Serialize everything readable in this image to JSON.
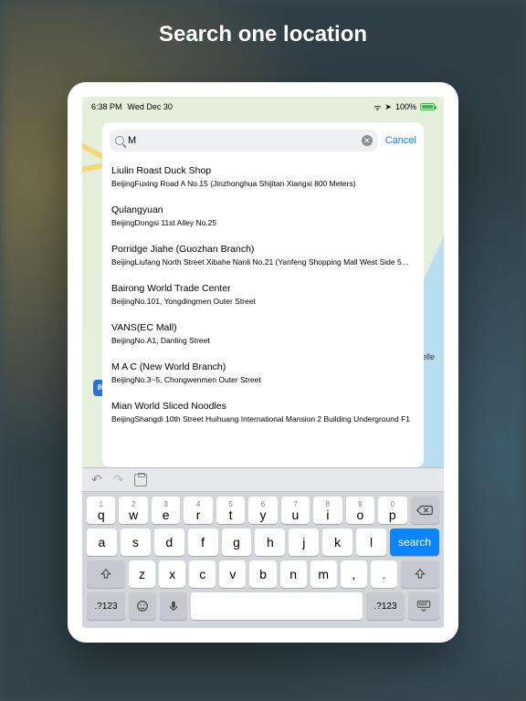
{
  "page": {
    "title": "Search one location"
  },
  "status": {
    "time": "6:38 PM",
    "date": "Wed Dec 30",
    "battery_pct": "100%"
  },
  "map": {
    "shield_label": "80",
    "place_label": "Rochelle"
  },
  "search": {
    "query": "M",
    "cancel_label": "Cancel",
    "clear_glyph": "✕"
  },
  "results": [
    {
      "title": "Liulin Roast Duck Shop",
      "subtitle": "BeijingFuxing Road A No.15 (Jinzhonghua Shijitan Xiangxi 800 Meters)"
    },
    {
      "title": "Qulangyuan",
      "subtitle": "BeijingDongsi 11st Alley No.25"
    },
    {
      "title": "Porridge Jiahe (Guozhan Branch)",
      "subtitle": "BeijingLiufang North Street Xibahe Nanli No.21 (Yanfeng Shopping Mall West Side 5…"
    },
    {
      "title": "Bairong World Trade Center",
      "subtitle": "BeijingNo.101, Yongdingmen Outer Street"
    },
    {
      "title": "VANS(EC Mall)",
      "subtitle": "BeijingNo.A1, Danling Street"
    },
    {
      "title": "M A C (New World Branch)",
      "subtitle": "BeijingNo.3~5, Chongwenmen Outer Street"
    },
    {
      "title": "Mian World Sliced Noodles",
      "subtitle": "BeijingShangdi 10th Street Huihuang International Mansion 2 Building Underground F1"
    }
  ],
  "keyboard": {
    "toolbar": {
      "undo_glyph": "↶",
      "redo_glyph": "↷"
    },
    "row1_nums": [
      "1",
      "2",
      "3",
      "4",
      "5",
      "6",
      "7",
      "8",
      "9",
      "0"
    ],
    "row1": [
      "q",
      "w",
      "e",
      "r",
      "t",
      "y",
      "u",
      "i",
      "o",
      "p"
    ],
    "row2": [
      "a",
      "s",
      "d",
      "f",
      "g",
      "h",
      "j",
      "k",
      "l"
    ],
    "search_label": "search",
    "row3": [
      "z",
      "x",
      "c",
      "v",
      "b",
      "n",
      "m",
      ",",
      "."
    ],
    "mode_label": ".?123"
  }
}
